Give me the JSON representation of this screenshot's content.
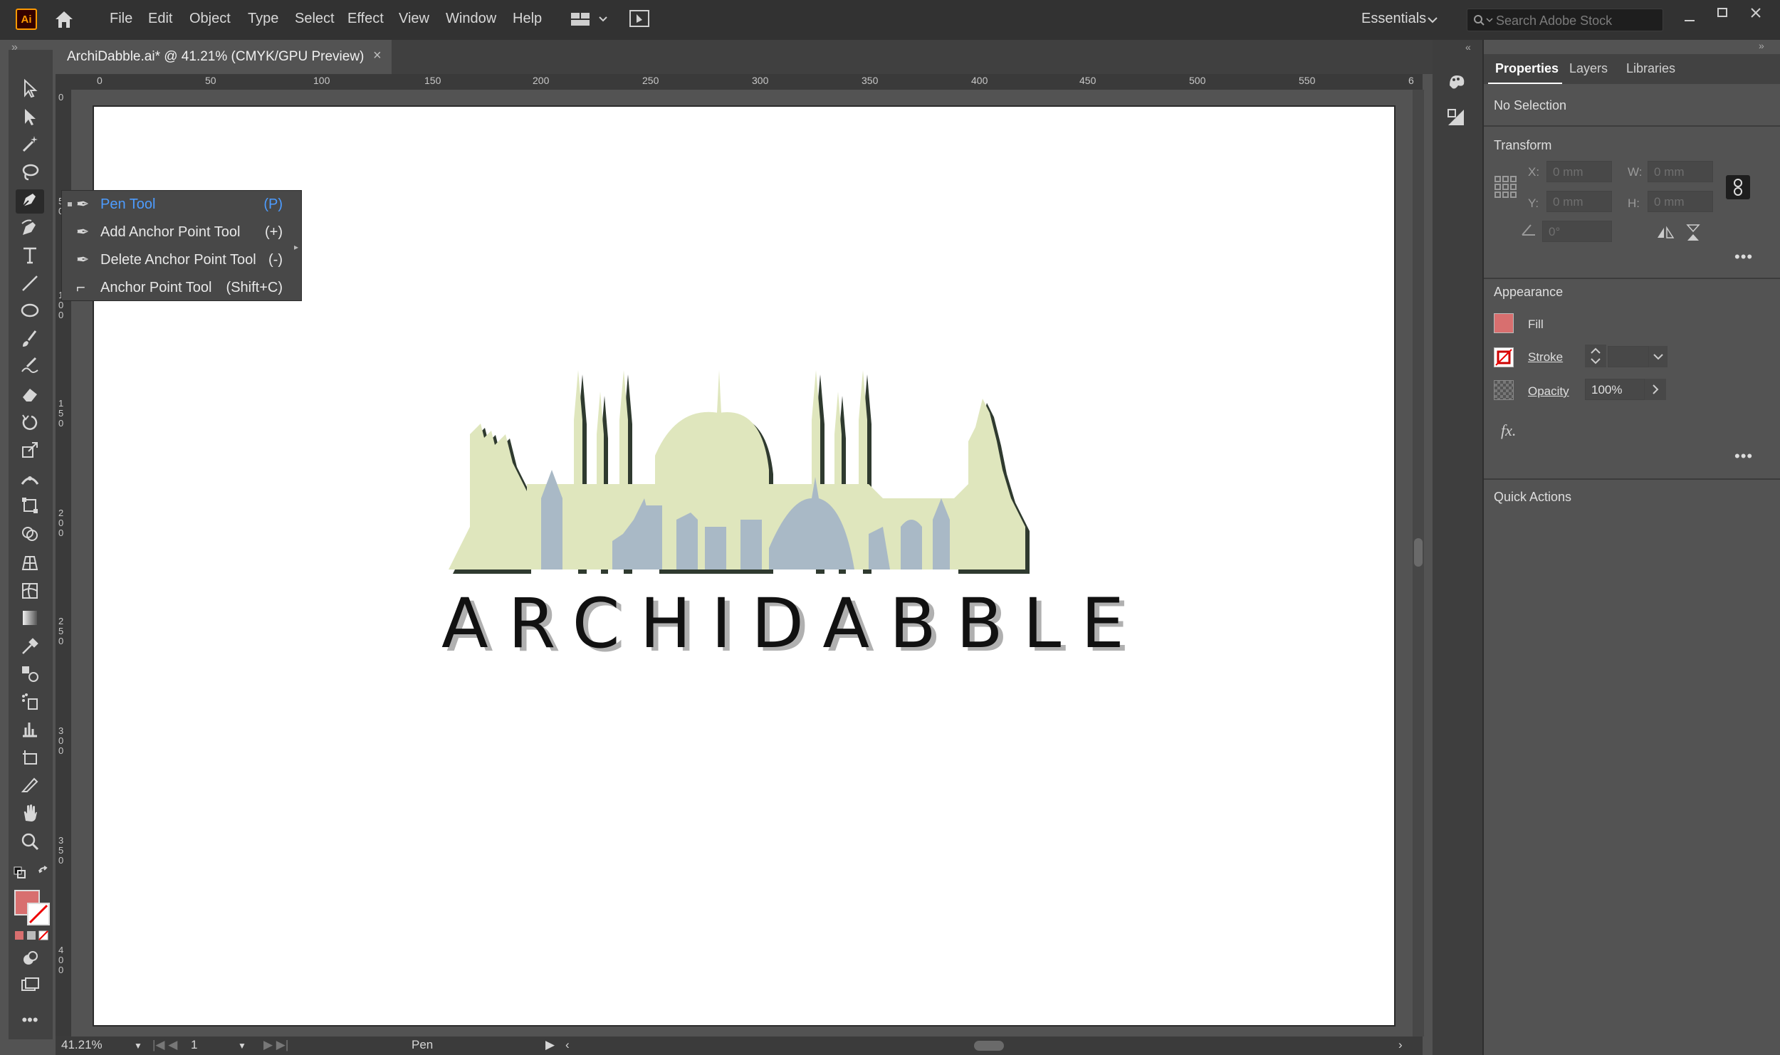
{
  "menubar": {
    "app_logo": "Ai",
    "items": [
      "File",
      "Edit",
      "Object",
      "Type",
      "Select",
      "Effect",
      "View",
      "Window",
      "Help"
    ],
    "workspace": "Essentials",
    "search_placeholder": "Search Adobe Stock"
  },
  "document_tab": {
    "title": "ArchiDabble.ai* @ 41.21% (CMYK/GPU Preview)",
    "close": "×"
  },
  "ruler": {
    "h_ticks": [
      "0",
      "50",
      "100",
      "150",
      "200",
      "250",
      "300",
      "350",
      "400",
      "450",
      "500",
      "550",
      "6"
    ],
    "v_ticks": [
      "0",
      "5\n0",
      "1\n0\n0",
      "1\n5\n0",
      "2\n0\n0",
      "2\n5\n0",
      "3\n0\n0",
      "3\n5\n0",
      "4\n0\n0"
    ]
  },
  "flyout": {
    "items": [
      {
        "label": "Pen Tool",
        "shortcut": "(P)",
        "selected": true
      },
      {
        "label": "Add Anchor Point Tool",
        "shortcut": "(+)",
        "selected": false
      },
      {
        "label": "Delete Anchor Point Tool",
        "shortcut": "(-)",
        "selected": false
      },
      {
        "label": "Anchor Point Tool",
        "shortcut": "(Shift+C)",
        "selected": false
      }
    ]
  },
  "artwork": {
    "wordmark": "ARCHIDABBLE",
    "colors": {
      "green": "#dfe6bd",
      "blue": "#a9b9c6",
      "outline": "#2f3a2f"
    }
  },
  "statusbar": {
    "zoom": "41.21%",
    "artboard": "1",
    "tool": "Pen"
  },
  "properties": {
    "tabs": [
      "Properties",
      "Layers",
      "Libraries"
    ],
    "selection": "No Selection",
    "transform": {
      "title": "Transform",
      "x_label": "X:",
      "x_value": "0 mm",
      "y_label": "Y:",
      "y_value": "0 mm",
      "w_label": "W:",
      "w_value": "0 mm",
      "h_label": "H:",
      "h_value": "0 mm",
      "angle_value": "0°"
    },
    "appearance": {
      "title": "Appearance",
      "fill_label": "Fill",
      "stroke_label": "Stroke",
      "opacity_label": "Opacity",
      "opacity_value": "100%",
      "fx_label": "fx."
    },
    "quick_actions": "Quick Actions",
    "more": "•••"
  },
  "fill_color": "#d86f6f"
}
